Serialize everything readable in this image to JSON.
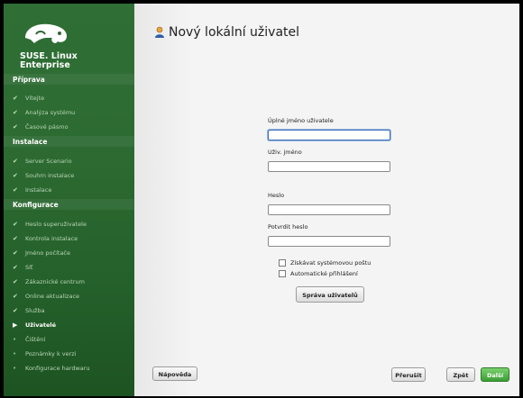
{
  "sidebar": {
    "brand": [
      "SUSE. Linux",
      "Enterprise"
    ],
    "sections": {
      "priprava": "Příprava",
      "instalace": "Instalace",
      "konfigurace": "Konfigurace"
    },
    "priprava_steps": [
      "Vítejte",
      "Analýza systému",
      "Časové pásmo"
    ],
    "instalace_steps": [
      "Server Scenario",
      "Souhrn instalace",
      "Instalace"
    ],
    "konfigurace_steps": [
      "Heslo superuživatele",
      "Kontrola instalace",
      "Jméno počítače",
      "Síť",
      "Zákaznické centrum",
      "Online aktualizace",
      "Služba",
      "Uživatelé",
      "Čištění",
      "Poznámky k verzi",
      "Konfigurace hardwaru"
    ]
  },
  "main": {
    "title": "Nový lokální uživatel",
    "full_name_label": "Úplné jméno uživatele",
    "username_label": "Uživ. jméno",
    "password_label": "Heslo",
    "confirm_label": "Potvrdit heslo",
    "receive_mail_label": "Získávat systémovou poštu",
    "autologin_label": "Automatické přihlášení",
    "manage_users_button": "Správa uživatelů"
  },
  "footer": {
    "help": "Nápověda",
    "abort": "Přerušit",
    "back": "Zpět",
    "next": "Další"
  },
  "colors": {
    "sidebar_green": "#2c6a31",
    "next_button": "#3c9e35",
    "content_bg": "#f4f4f4"
  }
}
